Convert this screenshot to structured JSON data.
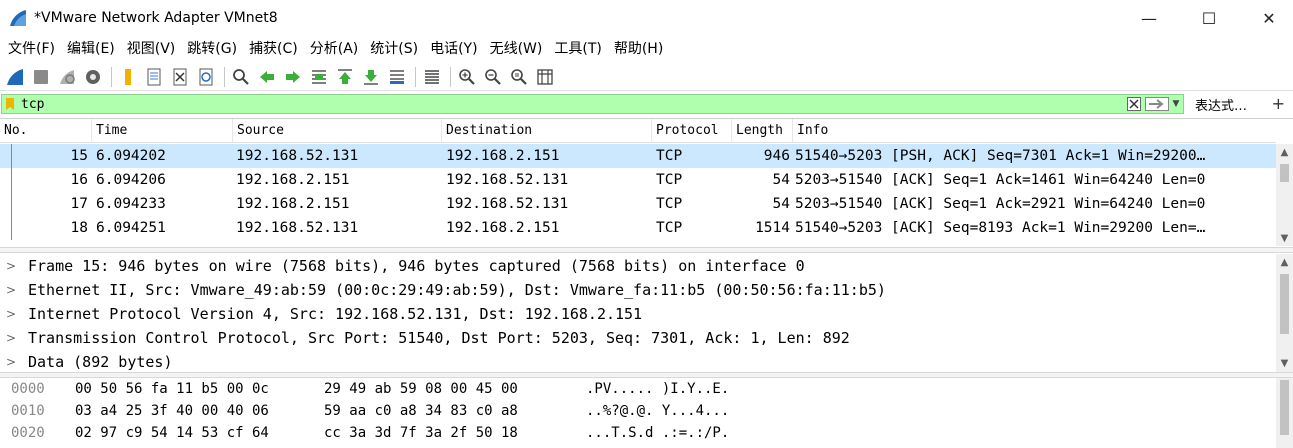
{
  "window": {
    "title": "*VMware Network Adapter VMnet8",
    "minimize": "—",
    "maximize": "☐",
    "close": "✕"
  },
  "menu": [
    "文件(F)",
    "编辑(E)",
    "视图(V)",
    "跳转(G)",
    "捕获(C)",
    "分析(A)",
    "统计(S)",
    "电话(Y)",
    "无线(W)",
    "工具(T)",
    "帮助(H)"
  ],
  "toolbar": {
    "icons": [
      "start-capture-icon",
      "stop-capture-icon",
      "restart-capture-icon",
      "capture-options-icon",
      "open-file-icon",
      "save-file-icon",
      "close-file-icon",
      "reload-file-icon",
      "find-packet-icon",
      "go-back-icon",
      "go-forward-icon",
      "go-to-packet-icon",
      "go-first-icon",
      "go-last-icon",
      "auto-scroll-icon",
      "colorize-icon",
      "zoom-in-icon",
      "zoom-out-icon",
      "zoom-normal-icon",
      "resize-columns-icon"
    ]
  },
  "filter": {
    "value": "tcp",
    "expression_label": "表达式…",
    "add_label": "+",
    "bg_color": "#afffaf"
  },
  "packet_list": {
    "columns": [
      "No.",
      "Time",
      "Source",
      "Destination",
      "Protocol",
      "Length",
      "Info"
    ],
    "rows": [
      {
        "no": "15",
        "time": "6.094202",
        "source": "192.168.52.131",
        "destination": "192.168.2.151",
        "protocol": "TCP",
        "length": "946",
        "info": "51540→5203 [PSH, ACK] Seq=7301 Ack=1 Win=29200…",
        "selected": true
      },
      {
        "no": "16",
        "time": "6.094206",
        "source": "192.168.2.151",
        "destination": "192.168.52.131",
        "protocol": "TCP",
        "length": "54",
        "info": "5203→51540 [ACK] Seq=1 Ack=1461 Win=64240 Len=0",
        "selected": false
      },
      {
        "no": "17",
        "time": "6.094233",
        "source": "192.168.2.151",
        "destination": "192.168.52.131",
        "protocol": "TCP",
        "length": "54",
        "info": "5203→51540 [ACK] Seq=1 Ack=2921 Win=64240 Len=0",
        "selected": false
      },
      {
        "no": "18",
        "time": "6.094251",
        "source": "192.168.52.131",
        "destination": "192.168.2.151",
        "protocol": "TCP",
        "length": "1514",
        "info": "51540→5203 [ACK] Seq=8193 Ack=1 Win=29200 Len=…",
        "selected": false
      }
    ],
    "selected_color": "#cce8ff"
  },
  "details": [
    "Frame 15: 946 bytes on wire (7568 bits), 946 bytes captured (7568 bits) on interface 0",
    "Ethernet II, Src: Vmware_49:ab:59 (00:0c:29:49:ab:59), Dst: Vmware_fa:11:b5 (00:50:56:fa:11:b5)",
    "Internet Protocol Version 4, Src: 192.168.52.131, Dst: 192.168.2.151",
    "Transmission Control Protocol, Src Port: 51540, Dst Port: 5203, Seq: 7301, Ack: 1, Len: 892",
    "Data (892 bytes)"
  ],
  "hex": [
    {
      "offset": "0000",
      "bytes1": "00 50 56 fa 11 b5 00 0c",
      "bytes2": "29 49 ab 59 08 00 45 00",
      "ascii": ".PV..... )I.Y..E."
    },
    {
      "offset": "0010",
      "bytes1": "03 a4 25 3f 40 00 40 06",
      "bytes2": "59 aa c0 a8 34 83 c0 a8",
      "ascii": "..%?@.@. Y...4..."
    },
    {
      "offset": "0020",
      "bytes1": "02 97 c9 54 14 53 cf 64",
      "bytes2": "cc 3a 3d 7f 3a 2f 50 18",
      "ascii": "...T.S.d .:=.:/P."
    }
  ]
}
